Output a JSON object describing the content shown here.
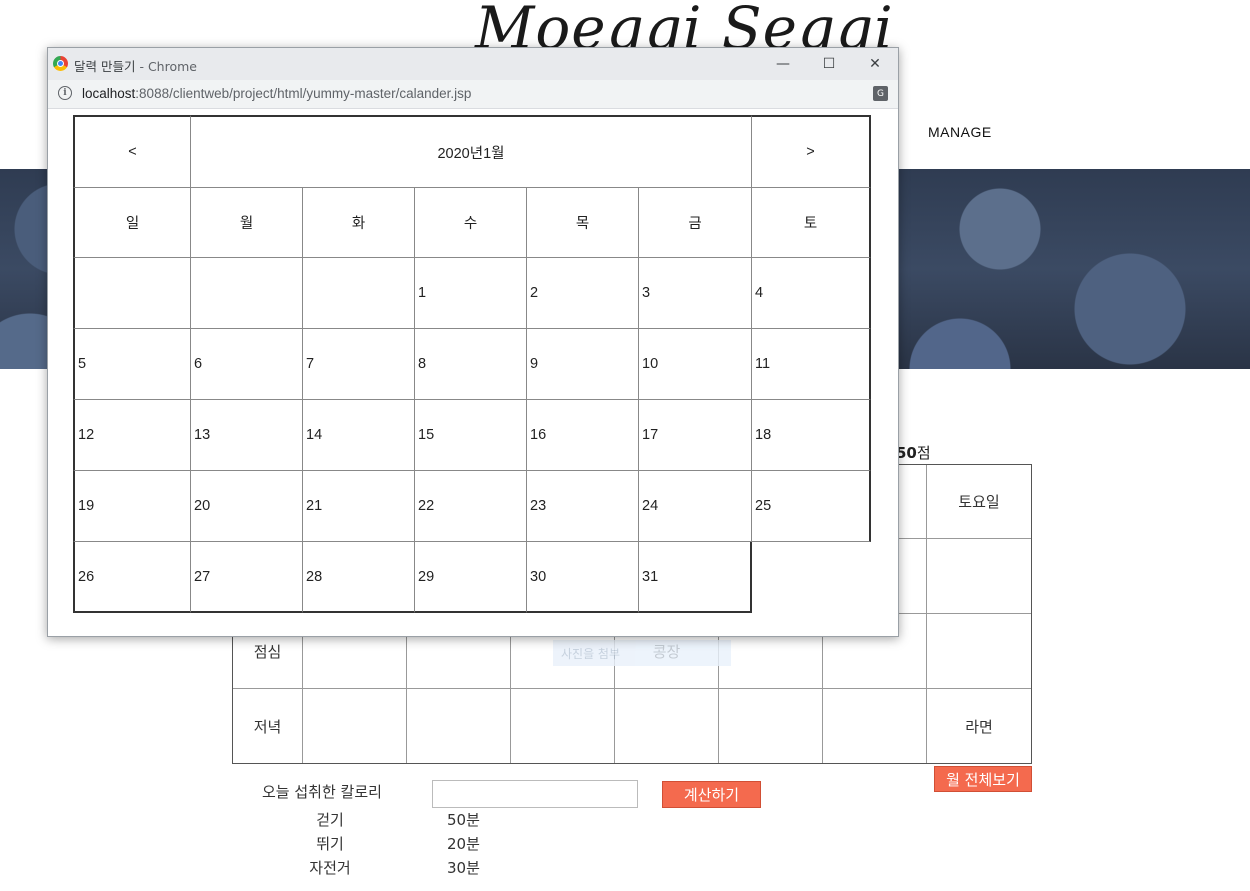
{
  "site": {
    "logo": "Moeggi Seggi",
    "nav_manage": "MANAGE",
    "score_value": "50",
    "score_unit": "점"
  },
  "week_table": {
    "header_last": "토요일",
    "rows": [
      {
        "label": "",
        "cells": [
          "",
          "",
          "",
          "",
          "",
          "",
          ""
        ]
      },
      {
        "label": "점심",
        "cells": [
          "",
          "",
          "",
          "콩장",
          "",
          "",
          ""
        ]
      },
      {
        "label": "저녁",
        "cells": [
          "",
          "",
          "",
          "",
          "",
          "",
          "라면"
        ]
      }
    ],
    "faint_tip": "사진을 첨부"
  },
  "controls": {
    "month_view_button": "월 전체보기",
    "calorie_label": "오늘 섭취한 칼로리",
    "calorie_input_value": "",
    "calc_button": "계산하기"
  },
  "exercise": [
    {
      "name": "걷기",
      "value": "50분"
    },
    {
      "name": "뛰기",
      "value": "20분"
    },
    {
      "name": "자전거",
      "value": "30분"
    }
  ],
  "popup": {
    "title": "달력 만들기",
    "app_suffix": " - Chrome",
    "url_host": "localhost",
    "url_path": ":8088/clientweb/project/html/yummy-master/calander.jsp",
    "minimize": "—",
    "maximize": "☐",
    "close": "✕"
  },
  "calendar": {
    "prev": "<",
    "next": ">",
    "title": "2020년1월",
    "weekdays": [
      "일",
      "월",
      "화",
      "수",
      "목",
      "금",
      "토"
    ],
    "weeks": [
      [
        "",
        "",
        "",
        "1",
        "2",
        "3",
        "4"
      ],
      [
        "5",
        "6",
        "7",
        "8",
        "9",
        "10",
        "11"
      ],
      [
        "12",
        "13",
        "14",
        "15",
        "16",
        "17",
        "18"
      ],
      [
        "19",
        "20",
        "21",
        "22",
        "23",
        "24",
        "25"
      ],
      [
        "26",
        "27",
        "28",
        "29",
        "30",
        "31"
      ]
    ]
  }
}
